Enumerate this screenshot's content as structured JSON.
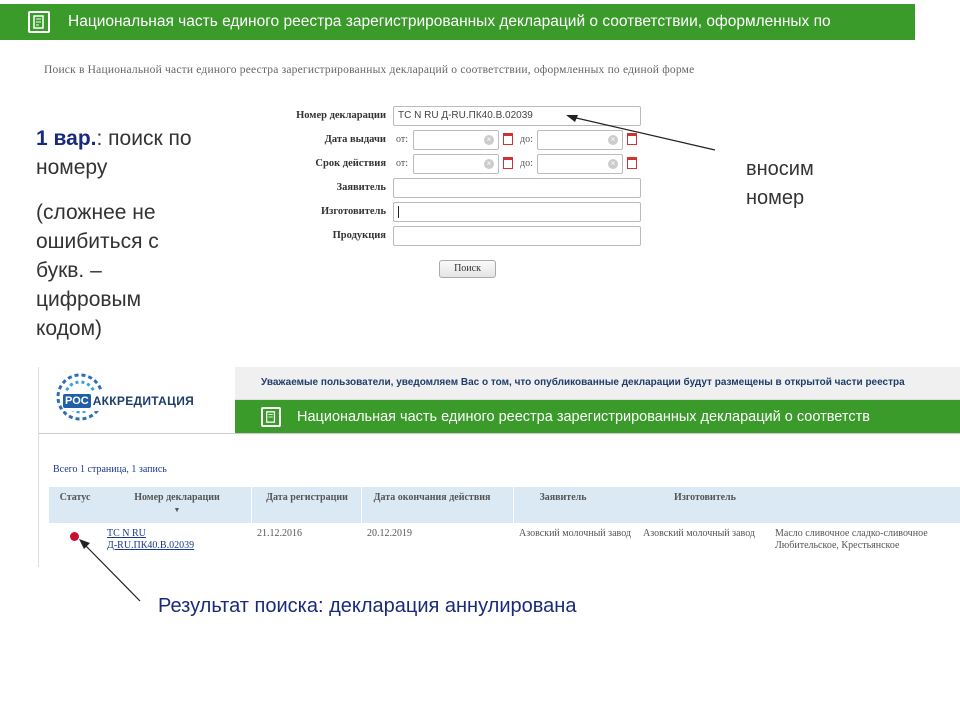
{
  "top_banner": {
    "title": "Национальная часть единого реестра зарегистрированных деклараций о соответствии, оформленных по",
    "icon": "document-edit-icon"
  },
  "search_form": {
    "heading": "Поиск в Национальной части единого реестра зарегистрированных деклараций о соответствии, оформленных по единой форме",
    "fields": {
      "number_label": "Номер декларации",
      "number_value": "ТС N RU Д-RU.ПК40.В.02039",
      "issue_date_label": "Дата выдачи",
      "validity_label": "Срок действия",
      "from_label": "от:",
      "to_label": "до:",
      "applicant_label": "Заявитель",
      "manufacturer_label": "Изготовитель",
      "product_label": "Продукция"
    },
    "search_button": "Поиск"
  },
  "annotations": {
    "variant_bold": "1 вар.",
    "variant_rest": ": поиск по номеру",
    "variant_note": "(сложнее не ошибиться с букв. – цифровым кодом)",
    "enter_number": "вносим номер",
    "result_caption": "Результат поиска: декларация аннулирована"
  },
  "results_page": {
    "logo_text_1": "РОС",
    "logo_text_2": "АККРЕДИТАЦИЯ",
    "notice": "Уважаемые пользователи, уведомляем Вас о том, что опубликованные декларации будут размещены в открытой части реестра",
    "banner_title": "Национальная часть единого реестра зарегистрированных деклараций о соответств",
    "pagination": "Всего 1 страница, 1 запись",
    "columns": [
      "Статус",
      "Номер декларации",
      "Дата регистрации",
      "Дата окончания действия",
      "Заявитель",
      "Изготовитель"
    ],
    "sort_icon": "sort-down-icon",
    "row": {
      "status_color": "#c8102e",
      "number_line1": "ТС N RU",
      "number_line2": "Д-RU.ПК40.В.02039",
      "registered": "21.12.2016",
      "expires": "20.12.2019",
      "applicant": "Азовский молочный завод",
      "manufacturer": "Азовский молочный завод",
      "product": "Масло сливочное сладко-сливочное Любительское, Крестьянское"
    }
  },
  "colors": {
    "green": "#3a9a2a",
    "table_header": "#dbe9f4",
    "link": "#1a3a8c"
  }
}
